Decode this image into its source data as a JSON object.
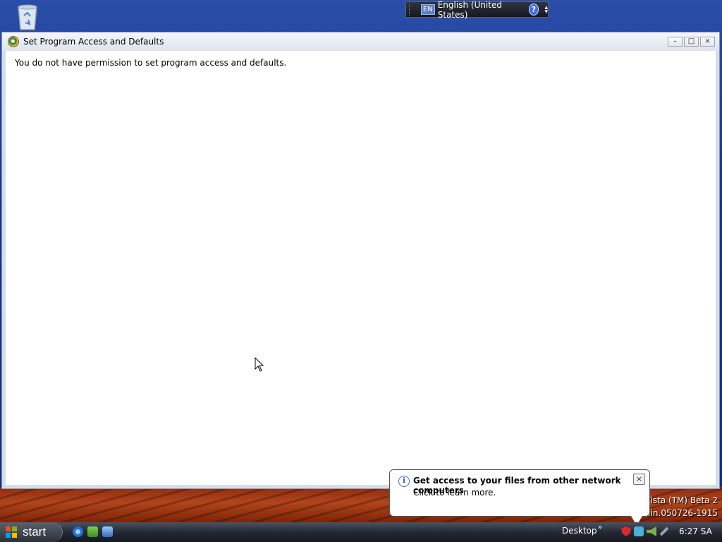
{
  "language_bar": {
    "code": "EN",
    "language": "English (United States)",
    "help_label": "?"
  },
  "window": {
    "title": "Set Program Access and Defaults",
    "message": "You do not have permission to set program access and defaults.",
    "buttons": {
      "minimize": "–",
      "maximize": "□",
      "close": "×"
    }
  },
  "balloon": {
    "title": "Get access to your files from other network computers",
    "text": "Click to learn more.",
    "close": "×"
  },
  "watermark": {
    "line1": "s Vista (TM) Beta 2",
    "line2": "main.050726-1915"
  },
  "taskbar": {
    "start_label": "start",
    "desktop_toolbar": "Desktop",
    "chevron": "»",
    "clock": "6:27 SA"
  },
  "colors": {
    "desktop_blue": "#12368f",
    "taskbar": "#242934"
  }
}
